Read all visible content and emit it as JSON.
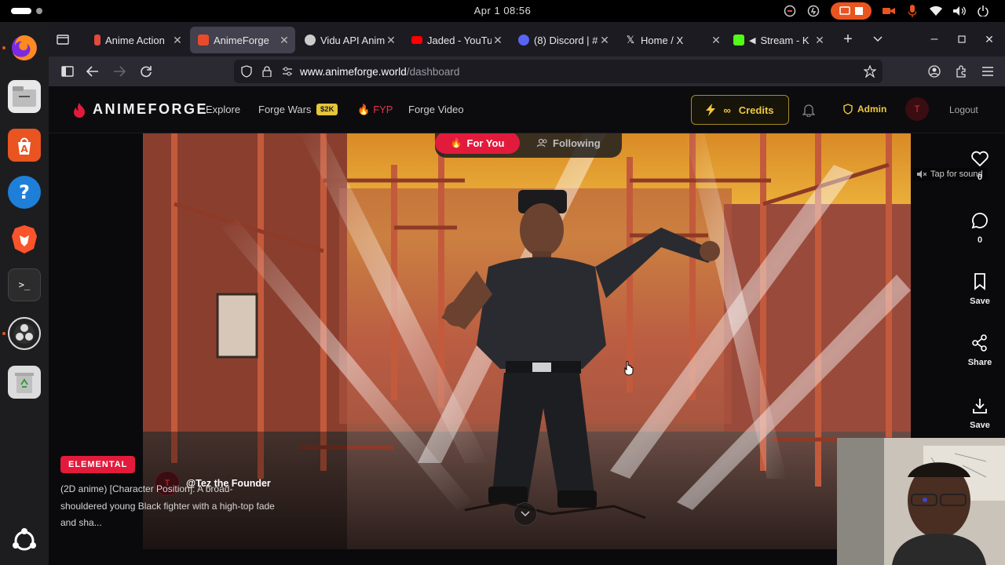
{
  "system": {
    "clock": "Apr 1  08:56"
  },
  "browser": {
    "tabs": [
      {
        "label": "Anime Action",
        "favicon_color": "#e24a3a",
        "active": false
      },
      {
        "label": "AnimeForge",
        "favicon_color": "#e94b2a",
        "active": true
      },
      {
        "label": "Vidu API Anim",
        "favicon_color": "#cccccc",
        "active": false
      },
      {
        "label": "Jaded - YouTu",
        "favicon_color": "#ff0000",
        "active": false
      },
      {
        "label": "(8) Discord | #",
        "favicon_color": "#5865f2",
        "active": false
      },
      {
        "label": "Home / X",
        "favicon_color": "#ffffff",
        "active": false
      },
      {
        "label": "Stream - K",
        "favicon_color": "#53fc18",
        "active": false
      }
    ],
    "url_domain": "www.animeforge.world",
    "url_path": "/dashboard"
  },
  "site": {
    "logo_text": "ANIMEFORGE",
    "nav": {
      "explore": "Explore",
      "forge_wars": "Forge Wars",
      "forge_wars_badge": "$2K",
      "fyp": "FYP",
      "forge_video": "Forge Video"
    },
    "credits_symbol": "∞",
    "credits_label": "Credits",
    "admin_label": "Admin",
    "avatar_initial": "T",
    "logout_label": "Logout"
  },
  "feed": {
    "for_you": "For You",
    "following": "Following",
    "tap_for_sound": "Tap for sound",
    "actions": {
      "likes": "0",
      "comments": "0",
      "save": "Save",
      "share": "Share",
      "download": "Save"
    },
    "creator_initial": "T",
    "creator_handle": "@Tez the Founder",
    "tag": "ELEMENTAL",
    "description_line1": "(2D anime) [Character Position]: A broad-",
    "description_line2": "shouldered young Black fighter with a high-top fade",
    "description_line3": "and sha..."
  },
  "colors": {
    "accent_red": "#e21b3c",
    "gold": "#f0c93f",
    "ubuntu_orange": "#e95420"
  }
}
